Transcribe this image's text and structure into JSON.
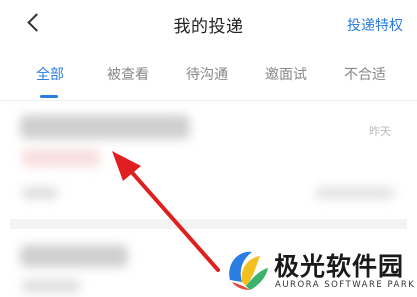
{
  "header": {
    "title": "我的投递",
    "right_link": "投递特权",
    "back_icon": "chevron-left-icon"
  },
  "tabs": [
    {
      "label": "全部",
      "active": true
    },
    {
      "label": "被查看",
      "active": false
    },
    {
      "label": "待沟通",
      "active": false
    },
    {
      "label": "邀面试",
      "active": false
    },
    {
      "label": "不合适",
      "active": false
    }
  ],
  "list": [
    {
      "time": "昨天"
    }
  ],
  "watermark": {
    "name": "极光软件园",
    "subtitle": "AURORA SOFTWARE PARK"
  },
  "colors": {
    "accent": "#2a7de1",
    "annotation_arrow": "#e02020"
  }
}
